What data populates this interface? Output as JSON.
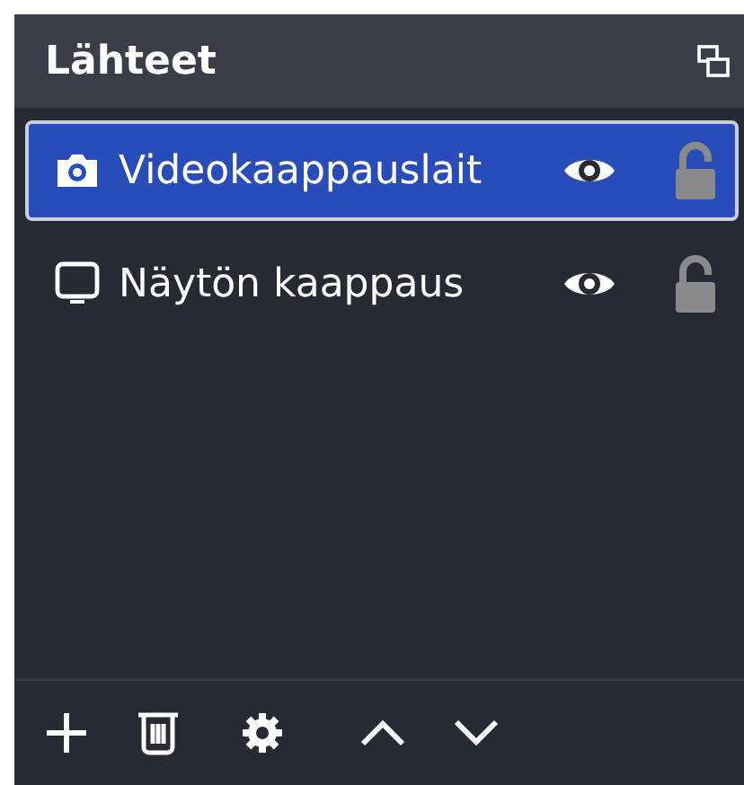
{
  "panel": {
    "title": "Lähteet"
  },
  "sources": [
    {
      "name": "Videokaappauslait",
      "kind": "camera",
      "selected": true,
      "visible": true,
      "locked": false
    },
    {
      "name": "Näytön kaappaus",
      "kind": "monitor",
      "selected": false,
      "visible": true,
      "locked": false
    }
  ],
  "toolbar": [
    {
      "kind": "add"
    },
    {
      "kind": "remove"
    },
    {
      "kind": "settings"
    },
    {
      "kind": "up"
    },
    {
      "kind": "down"
    }
  ]
}
